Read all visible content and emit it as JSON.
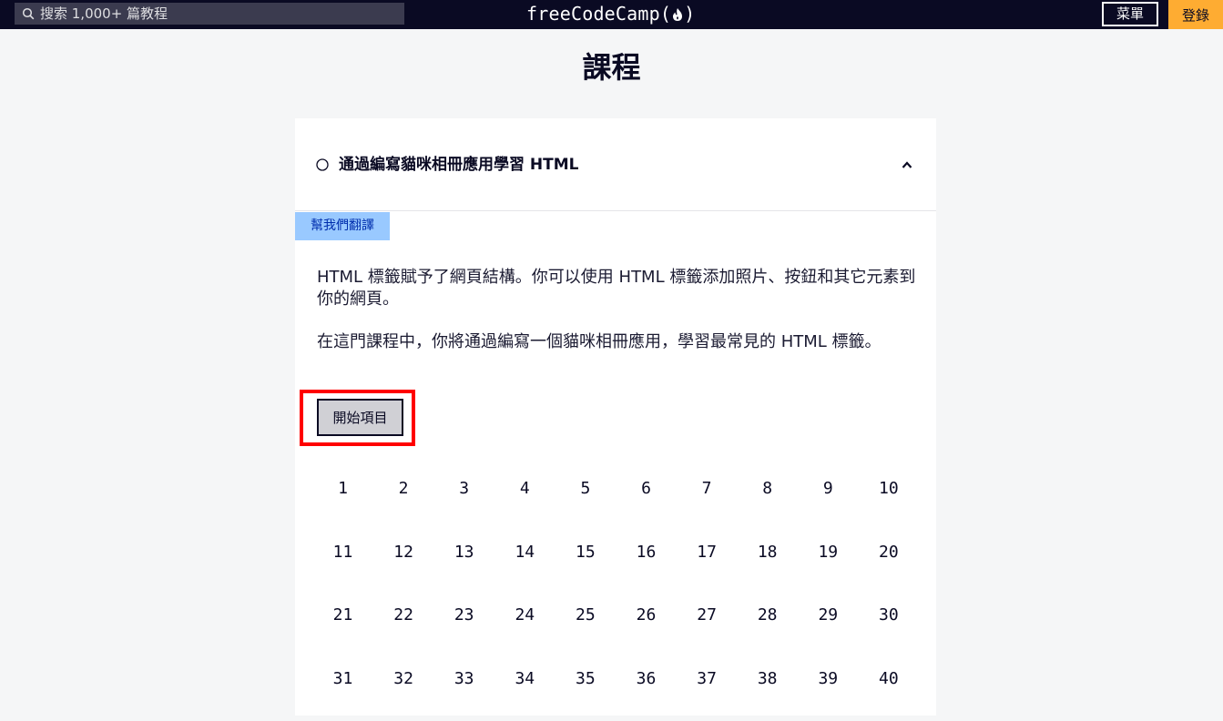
{
  "nav": {
    "search_placeholder": "搜索 1,000+ 篇教程",
    "logo_text": "freeCodeCamp(",
    "logo_close": ")",
    "menu_label": "菜單",
    "signin_label": "登錄"
  },
  "page_title": "課程",
  "block": {
    "title": "通過編寫貓咪相冊應用學習 HTML",
    "translate_label": "幫我們翻譯",
    "description_1": "HTML 標籤賦予了網頁結構。你可以使用 HTML 標籤添加照片、按鈕和其它元素到你的網頁。",
    "description_2": "在這門課程中，你將通過編寫一個貓咪相冊應用，學習最常見的 HTML 標籤。",
    "start_label": "開始項目",
    "steps": [
      "1",
      "2",
      "3",
      "4",
      "5",
      "6",
      "7",
      "8",
      "9",
      "10",
      "11",
      "12",
      "13",
      "14",
      "15",
      "16",
      "17",
      "18",
      "19",
      "20",
      "21",
      "22",
      "23",
      "24",
      "25",
      "26",
      "27",
      "28",
      "29",
      "30",
      "31",
      "32",
      "33",
      "34",
      "35",
      "36",
      "37",
      "38",
      "39",
      "40"
    ]
  },
  "colors": {
    "nav_bg": "#0a0a23",
    "signin_bg": "#feac32",
    "translate_bg": "#99c9ff",
    "highlight": "#ff0000"
  }
}
